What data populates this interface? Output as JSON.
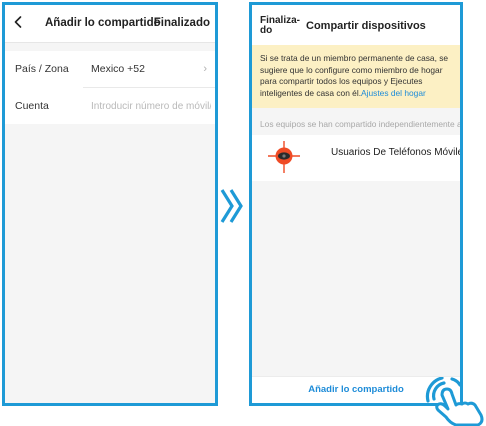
{
  "left_screen": {
    "title": "Añadir lo compartido",
    "done_label": "Finalizado",
    "rows": [
      {
        "label": "País / Zona",
        "value": "Mexico +52"
      },
      {
        "label": "Cuenta",
        "placeholder": "Introducir número de móvil/..."
      }
    ]
  },
  "right_screen": {
    "done_label": "Finaliza-do",
    "title": "Compartir dispositivos",
    "notice_text": "Si se trata de un miembro permanente de casa, se sugiere que lo configure como miembro de hogar para compartir todos los equipos y Ejecutes inteligentes de casa con él.",
    "notice_link": "Ajustes del hogar",
    "hint": "Los equipos se han compartido independientemente a",
    "device": {
      "name": "Usuarios De Teléfonos Móviles",
      "icon": "device-icon"
    },
    "add_button_label": "Añadir lo compartido"
  },
  "colors": {
    "frame": "#1e9ad6",
    "link": "#1e8cd8",
    "notice_bg": "#fcf0c4",
    "device_accent": "#ef4b25"
  }
}
